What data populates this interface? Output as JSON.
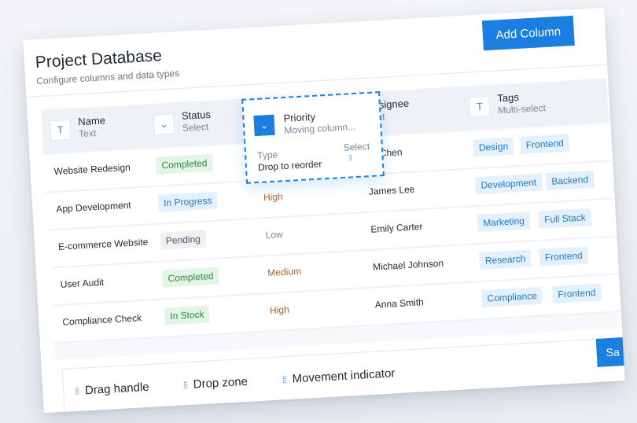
{
  "header": {
    "title": "Project Database",
    "subtitle": "Configure columns and data types",
    "add_column_label": "Add Column"
  },
  "columns": [
    {
      "icon": "text-icon",
      "glyph": "T",
      "name": "Name",
      "type": "Text"
    },
    {
      "icon": "chevron-down-icon",
      "glyph": "⌄",
      "name": "Status",
      "type": "Select"
    },
    {
      "icon": "",
      "glyph": "",
      "name": "",
      "type": ""
    },
    {
      "icon": "text-icon",
      "glyph": "",
      "name": "Assignee",
      "type": "Text"
    },
    {
      "icon": "text-icon",
      "glyph": "T",
      "name": "Tags",
      "type": "Multi-select"
    }
  ],
  "rows": [
    {
      "name": "Website Redesign",
      "status": "Completed",
      "priority": "",
      "assignee": "ah Chen",
      "tags": [
        "Design",
        "Frontend"
      ]
    },
    {
      "name": "App Development",
      "status": "In Progress",
      "priority": "High",
      "assignee": "James Lee",
      "tags": [
        "Development",
        "Backend"
      ]
    },
    {
      "name": "E-commerce Website",
      "status": "Pending",
      "priority": "Low",
      "assignee": "Emily Carter",
      "tags": [
        "Marketing",
        "Full Stack"
      ]
    },
    {
      "name": "User Audit",
      "status": "Completed",
      "priority": "Medium",
      "assignee": "Michael Johnson",
      "tags": [
        "Research",
        "Frontend"
      ]
    },
    {
      "name": "Compliance Check",
      "status": "In Stock",
      "priority": "High",
      "assignee": "Anna Smith",
      "tags": [
        "Compliance",
        "Frontend"
      ]
    }
  ],
  "dragged_column": {
    "name": "Priority",
    "status": "Moving column...",
    "type_label": "Type",
    "type_value": "Select",
    "hint": "Drop to reorder",
    "icon": "chevron-down-icon"
  },
  "legend": {
    "items": [
      "Drag handle",
      "Drop zone",
      "Movement indicator"
    ]
  },
  "save_label": "Sa",
  "colors": {
    "accent": "#1a7fe0",
    "completed_bg": "#e3f5e6",
    "completed_fg": "#2f8a46",
    "progress_bg": "#e4f1fc",
    "progress_fg": "#1f78cc",
    "pending_bg": "#eef0f3",
    "pending_fg": "#4a5663",
    "high": "#b5612a",
    "medium": "#b5612a",
    "low": "#7a8694"
  }
}
